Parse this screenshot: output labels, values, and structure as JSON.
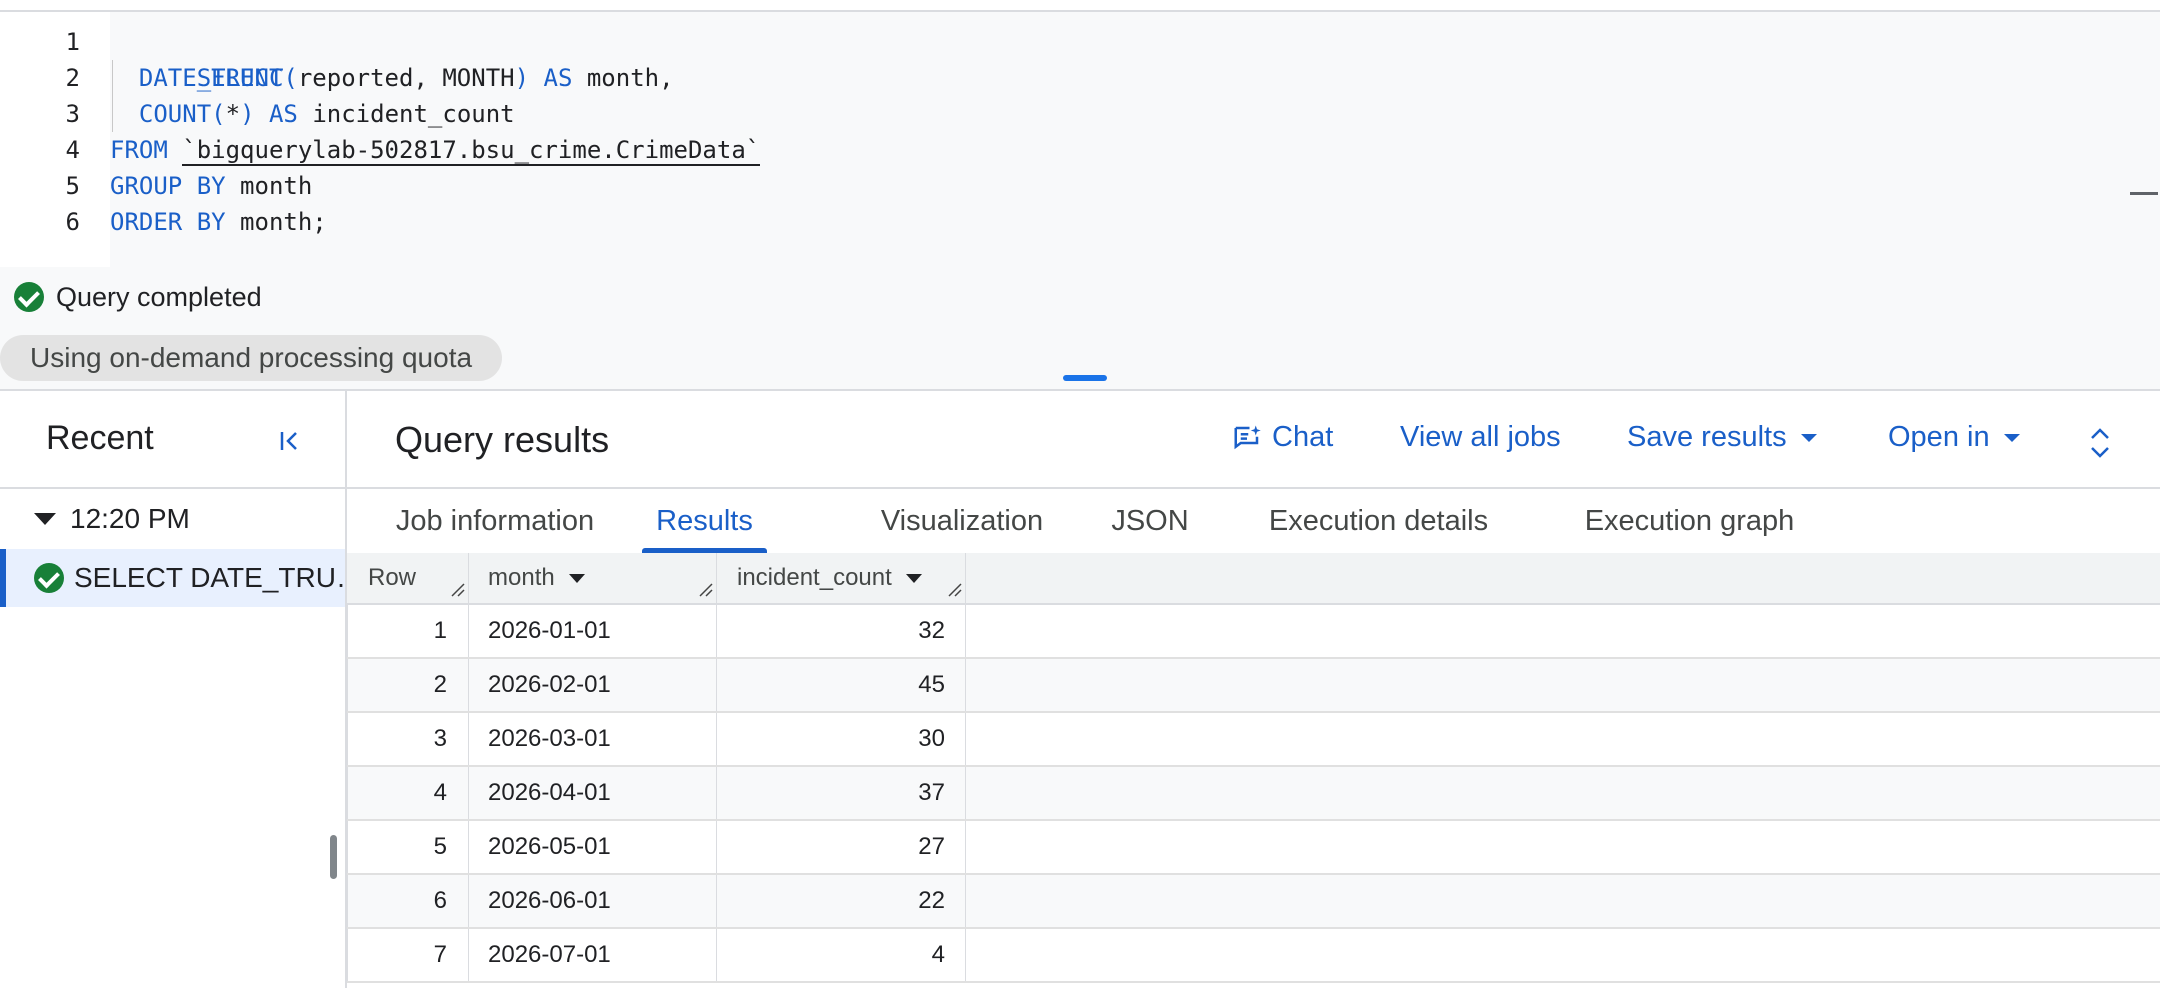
{
  "editor": {
    "lines": [
      {
        "num": "1"
      },
      {
        "num": "2"
      },
      {
        "num": "3"
      },
      {
        "num": "4"
      },
      {
        "num": "5"
      },
      {
        "num": "6"
      }
    ],
    "tokens": {
      "select": "SELECT",
      "date_trunc": "DATE_TRUNC(",
      "reported_month": "reported, MONTH",
      "close_paren_as": ") AS",
      "month_comma": " month,",
      "count_fn": "COUNT(",
      "star": "*",
      "close_paren": ")",
      "as": " AS",
      "incident_count": " incident_count",
      "from": "FROM",
      "table": "`bigquerylab-502817.bsu_crime.CrimeData`",
      "group_by": "GROUP BY",
      "month": " month",
      "order_by": "ORDER BY",
      "month_semicolon": " month;"
    }
  },
  "status": {
    "message": "Query completed",
    "quota": "Using on-demand processing quota"
  },
  "recent": {
    "title": "Recent",
    "time": "12:20 PM",
    "job": "SELECT DATE_TRU…"
  },
  "results": {
    "title": "Query results",
    "toolbar": {
      "chat": "Chat",
      "view_all_jobs": "View all jobs",
      "save_results": "Save results",
      "open_in": "Open in"
    },
    "tabs": [
      "Job information",
      "Results",
      "Visualization",
      "JSON",
      "Execution details",
      "Execution graph"
    ],
    "active_tab": "Results",
    "columns": [
      "Row",
      "month",
      "incident_count"
    ],
    "rows": [
      {
        "row": "1",
        "month": "2026-01-01",
        "incident_count": "32"
      },
      {
        "row": "2",
        "month": "2026-02-01",
        "incident_count": "45"
      },
      {
        "row": "3",
        "month": "2026-03-01",
        "incident_count": "30"
      },
      {
        "row": "4",
        "month": "2026-04-01",
        "incident_count": "37"
      },
      {
        "row": "5",
        "month": "2026-05-01",
        "incident_count": "27"
      },
      {
        "row": "6",
        "month": "2026-06-01",
        "incident_count": "22"
      },
      {
        "row": "7",
        "month": "2026-07-01",
        "incident_count": "4"
      }
    ]
  },
  "colors": {
    "accent": "#1a5fc8",
    "success": "#188038",
    "keyword": "#1a5fc8"
  }
}
